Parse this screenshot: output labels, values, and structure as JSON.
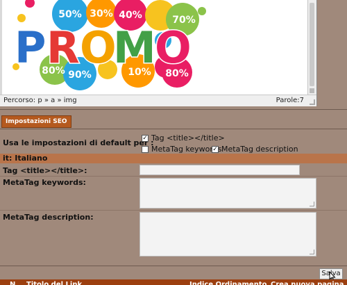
{
  "editor": {
    "image": {
      "word": "PROMO",
      "badges": [
        "50%",
        "30%",
        "40%",
        "70%",
        "80%",
        "90%",
        "10%",
        "80%"
      ]
    },
    "statusbar": {
      "path": "Percorso: p » a » img",
      "word_count": "Parole:7"
    }
  },
  "seo": {
    "tab_label": "Impostazioni SEO",
    "defaults_label": "Usa le impostazioni di default per :",
    "options": [
      {
        "label": "Tag <title></title>",
        "checked": true
      },
      {
        "label": "MetaTag keywords",
        "checked": false
      },
      {
        "label": "MetaTag description",
        "checked": true
      }
    ],
    "language_label": "it: Italiano",
    "title_label": "Tag <title></title>:",
    "title_value": "",
    "keywords_label": "MetaTag keywords:",
    "keywords_value": "",
    "description_label": "MetaTag description:",
    "description_value": ""
  },
  "actions": {
    "save_label": "Salva"
  },
  "table": {
    "columns": [
      "N.",
      "Titolo del Link",
      "Indice Ordinamento",
      "Crea nuova pagina"
    ]
  }
}
